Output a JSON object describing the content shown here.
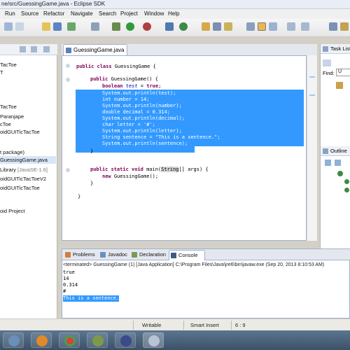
{
  "window": {
    "title": "ne/src/GuessingGame.java - Eclipse SDK"
  },
  "menu": [
    "Run",
    "Source",
    "Refactor",
    "Navigate",
    "Search",
    "Project",
    "Window",
    "Help"
  ],
  "package_explorer": {
    "items": [
      {
        "label": "TacToe"
      },
      {
        "label": "T"
      },
      {
        "label": "TacToe"
      },
      {
        "label": "Paranjape"
      },
      {
        "label": "cToe"
      },
      {
        "label": "oidGUITicTacToe"
      },
      {
        "label": "t package)"
      },
      {
        "label": "GuessingGame.java"
      },
      {
        "label": " Library",
        "extra": "[JavaSE-1.6]"
      },
      {
        "label": "oidGUITicTacToeV2"
      },
      {
        "label": "oidGUITicTacToe"
      },
      {
        "label": "oid Project"
      }
    ]
  },
  "editor": {
    "tab_label": "GuessingGame.java",
    "lines": {
      "l1_kw": "public class",
      "l1_rest": " GuessingGame {",
      "l2_kw": "public",
      "l2_rest": " GuessingGame() {",
      "l3_kw": "boolean",
      "l3_pre": " ",
      "l3_fld": "test",
      "l3_mid": " = ",
      "l3_val": "true",
      "l3_end": ";",
      "s1": "System.out.println(test);",
      "s2": "int number = 14;",
      "s3": "System.out.println(number);",
      "s4": "double decimal = 0.314;",
      "s5": "System.out.println(decimal);",
      "s6": "char letter = '#';",
      "s7": "System.out.println(letter);",
      "s8": "String sentence = \"This is a sentence.\";",
      "s9": "System.out.println(sentence);",
      "c1": "}",
      "m_kw1": "public static void",
      "m_rest": " main(",
      "m_type": "String",
      "m_rest2": "[] args) {",
      "n_kw": "new",
      "n_rest": " GuessingGame();",
      "c2": "}",
      "c3": "}"
    }
  },
  "right_panels": {
    "task_list": "Task List",
    "find_label": "Find:",
    "find_value": "U",
    "outline": "Outline"
  },
  "bottom_tabs": [
    {
      "label": "Problems"
    },
    {
      "label": "Javadoc"
    },
    {
      "label": "Declaration"
    },
    {
      "label": "Console"
    }
  ],
  "console": {
    "header": "<terminated> GuessingGame (1) [Java Application] C:\\Program Files\\Java\\jre6\\bin\\javaw.exe (Sep 20, 2013 8:10:53 AM)",
    "lines": [
      "true",
      "14",
      "0.314",
      "#"
    ],
    "highlighted_line": "This is a sentence."
  },
  "status": {
    "mode": "Writable",
    "insert": "Smart Insert",
    "position": "6 : 9"
  }
}
